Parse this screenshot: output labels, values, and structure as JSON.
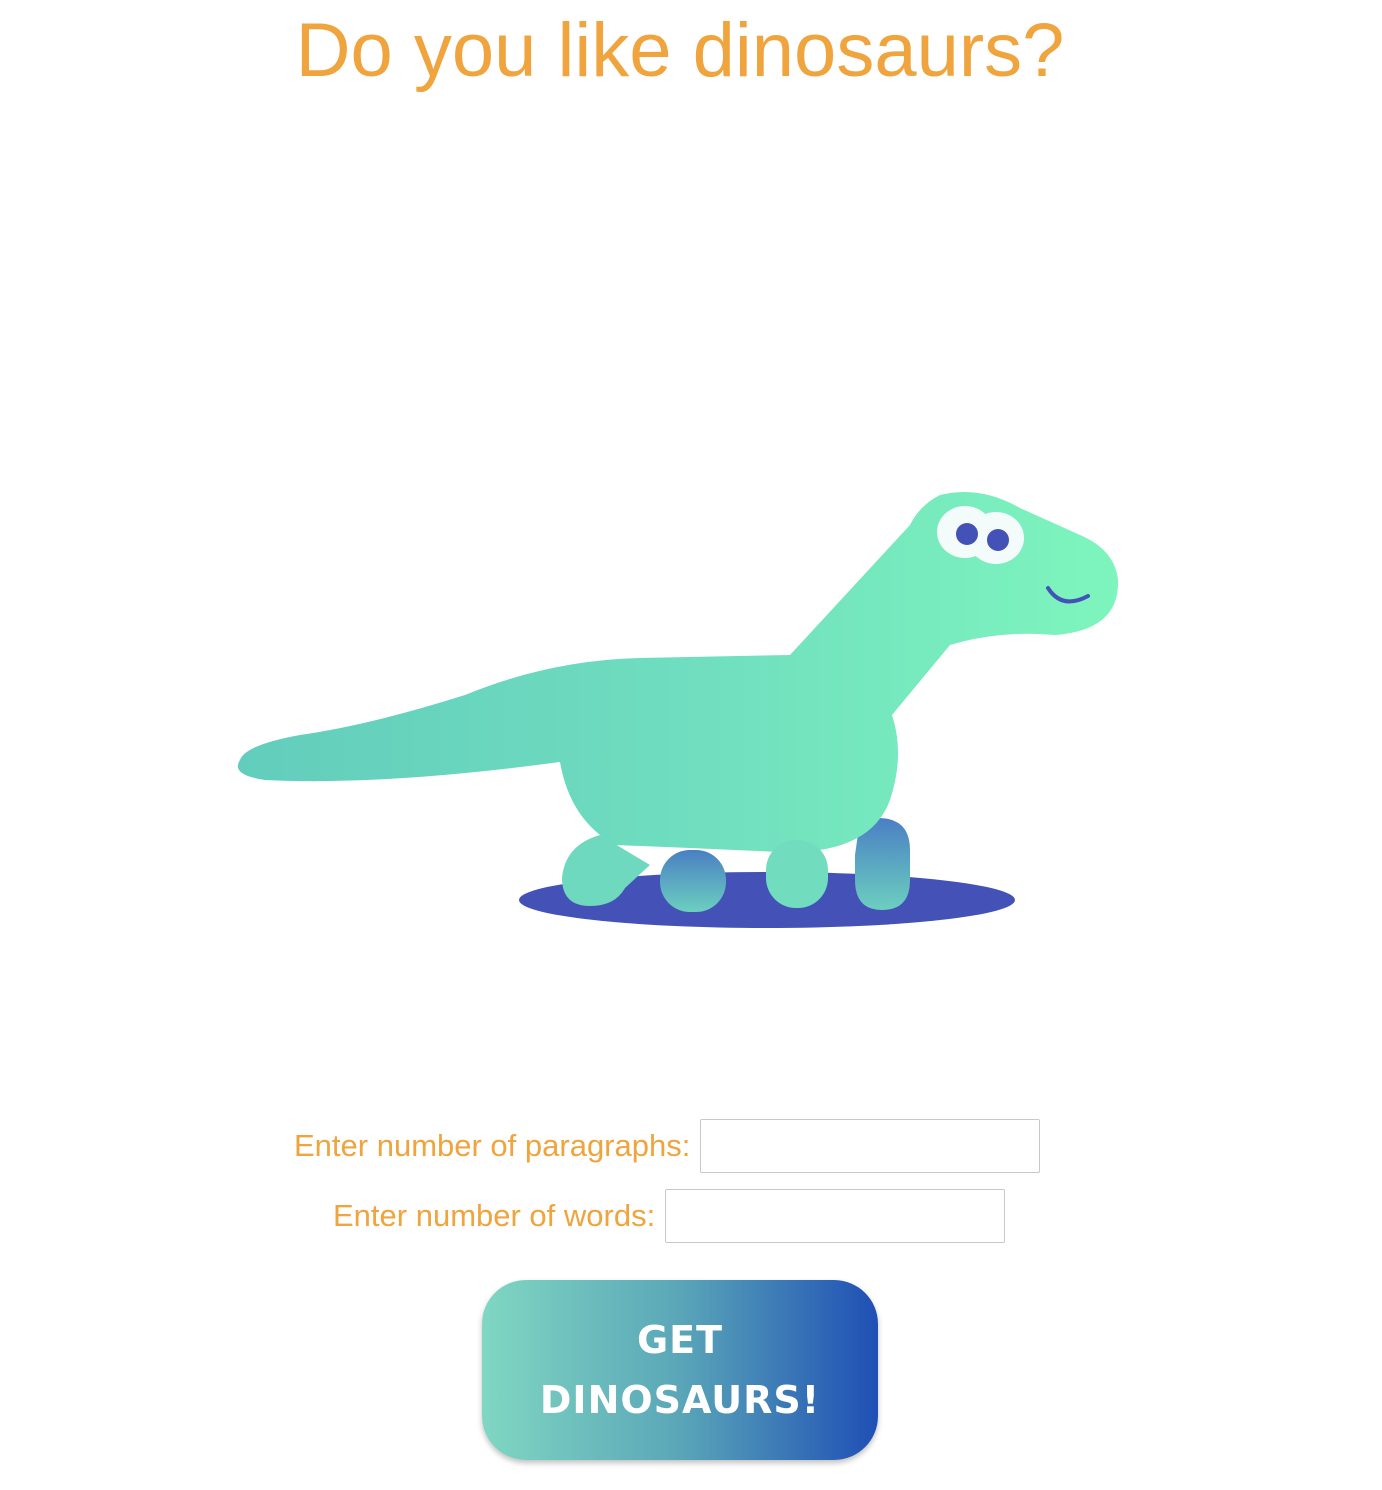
{
  "header": {
    "title": "Do you like dinosaurs?"
  },
  "illustration": {
    "name": "dinosaur-illustration",
    "colors": {
      "body": "#7ce6bd",
      "tail": "#62cdbc",
      "shadow": "#4452b8",
      "eye": "#4452b8",
      "mouth": "#4452b8"
    }
  },
  "form": {
    "paragraphs_label": "Enter number of paragraphs:",
    "paragraphs_value": "",
    "words_label": "Enter number of words:",
    "words_value": "",
    "submit_label": "GET DINOSAURS!"
  },
  "colors": {
    "accent": "#f0a43d",
    "button_gradient_start": "#80d7c2",
    "button_gradient_end": "#1f4fb5"
  }
}
